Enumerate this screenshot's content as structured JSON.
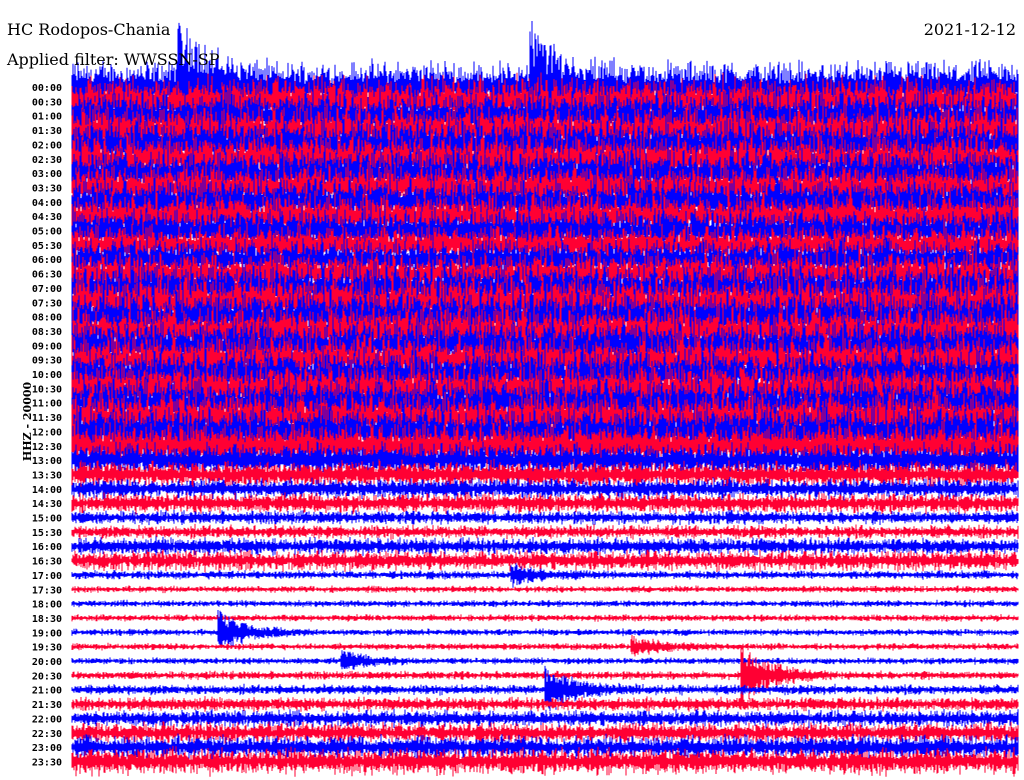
{
  "header": {
    "station": "HC Rodopos-Chania",
    "filter": "Applied filter: WWSSN-SP",
    "date": "2021-12-12",
    "channel": "HHZ - 20000"
  },
  "chart_data": {
    "type": "line",
    "title": "HC Rodopos-Chania",
    "subtitle": "Applied filter: WWSSN-SP",
    "ylabel": "HHZ - 20000",
    "minutes_per_row": 30,
    "colors": [
      "#0000ff",
      "#ff0033"
    ],
    "rows": [
      "00:00",
      "00:30",
      "01:00",
      "01:30",
      "02:00",
      "02:30",
      "03:00",
      "03:30",
      "04:00",
      "04:30",
      "05:00",
      "05:30",
      "06:00",
      "06:30",
      "07:00",
      "07:30",
      "08:00",
      "08:30",
      "09:00",
      "09:30",
      "10:00",
      "10:30",
      "11:00",
      "11:30",
      "12:00",
      "12:30",
      "13:00",
      "13:30",
      "14:00",
      "14:30",
      "15:00",
      "15:30",
      "16:00",
      "16:30",
      "17:00",
      "17:30",
      "18:00",
      "18:30",
      "19:00",
      "19:30",
      "20:00",
      "20:30",
      "21:00",
      "21:30",
      "22:00",
      "22:30",
      "23:00",
      "23:30"
    ],
    "relative_amplitude": [
      30,
      30,
      30,
      30,
      30,
      30,
      28,
      28,
      28,
      28,
      26,
      24,
      24,
      26,
      30,
      32,
      32,
      30,
      30,
      30,
      30,
      30,
      30,
      30,
      30,
      28,
      20,
      16,
      12,
      12,
      8,
      8,
      10,
      12,
      5,
      4,
      4,
      4,
      4,
      4,
      4,
      5,
      6,
      8,
      10,
      12,
      14,
      16
    ],
    "events": [
      {
        "row": "00:00",
        "minute": 3.3,
        "amplitude": 60
      },
      {
        "row": "00:00",
        "minute": 14.5,
        "amplitude": 50
      },
      {
        "row": "17:00",
        "minute": 13.9,
        "amplitude": 10
      },
      {
        "row": "19:00",
        "minute": 4.6,
        "amplitude": 22
      },
      {
        "row": "19:30",
        "minute": 17.7,
        "amplitude": 10
      },
      {
        "row": "20:00",
        "minute": 8.5,
        "amplitude": 10
      },
      {
        "row": "20:30",
        "minute": 21.2,
        "amplitude": 30
      },
      {
        "row": "21:00",
        "minute": 15.0,
        "amplitude": 22
      }
    ]
  }
}
